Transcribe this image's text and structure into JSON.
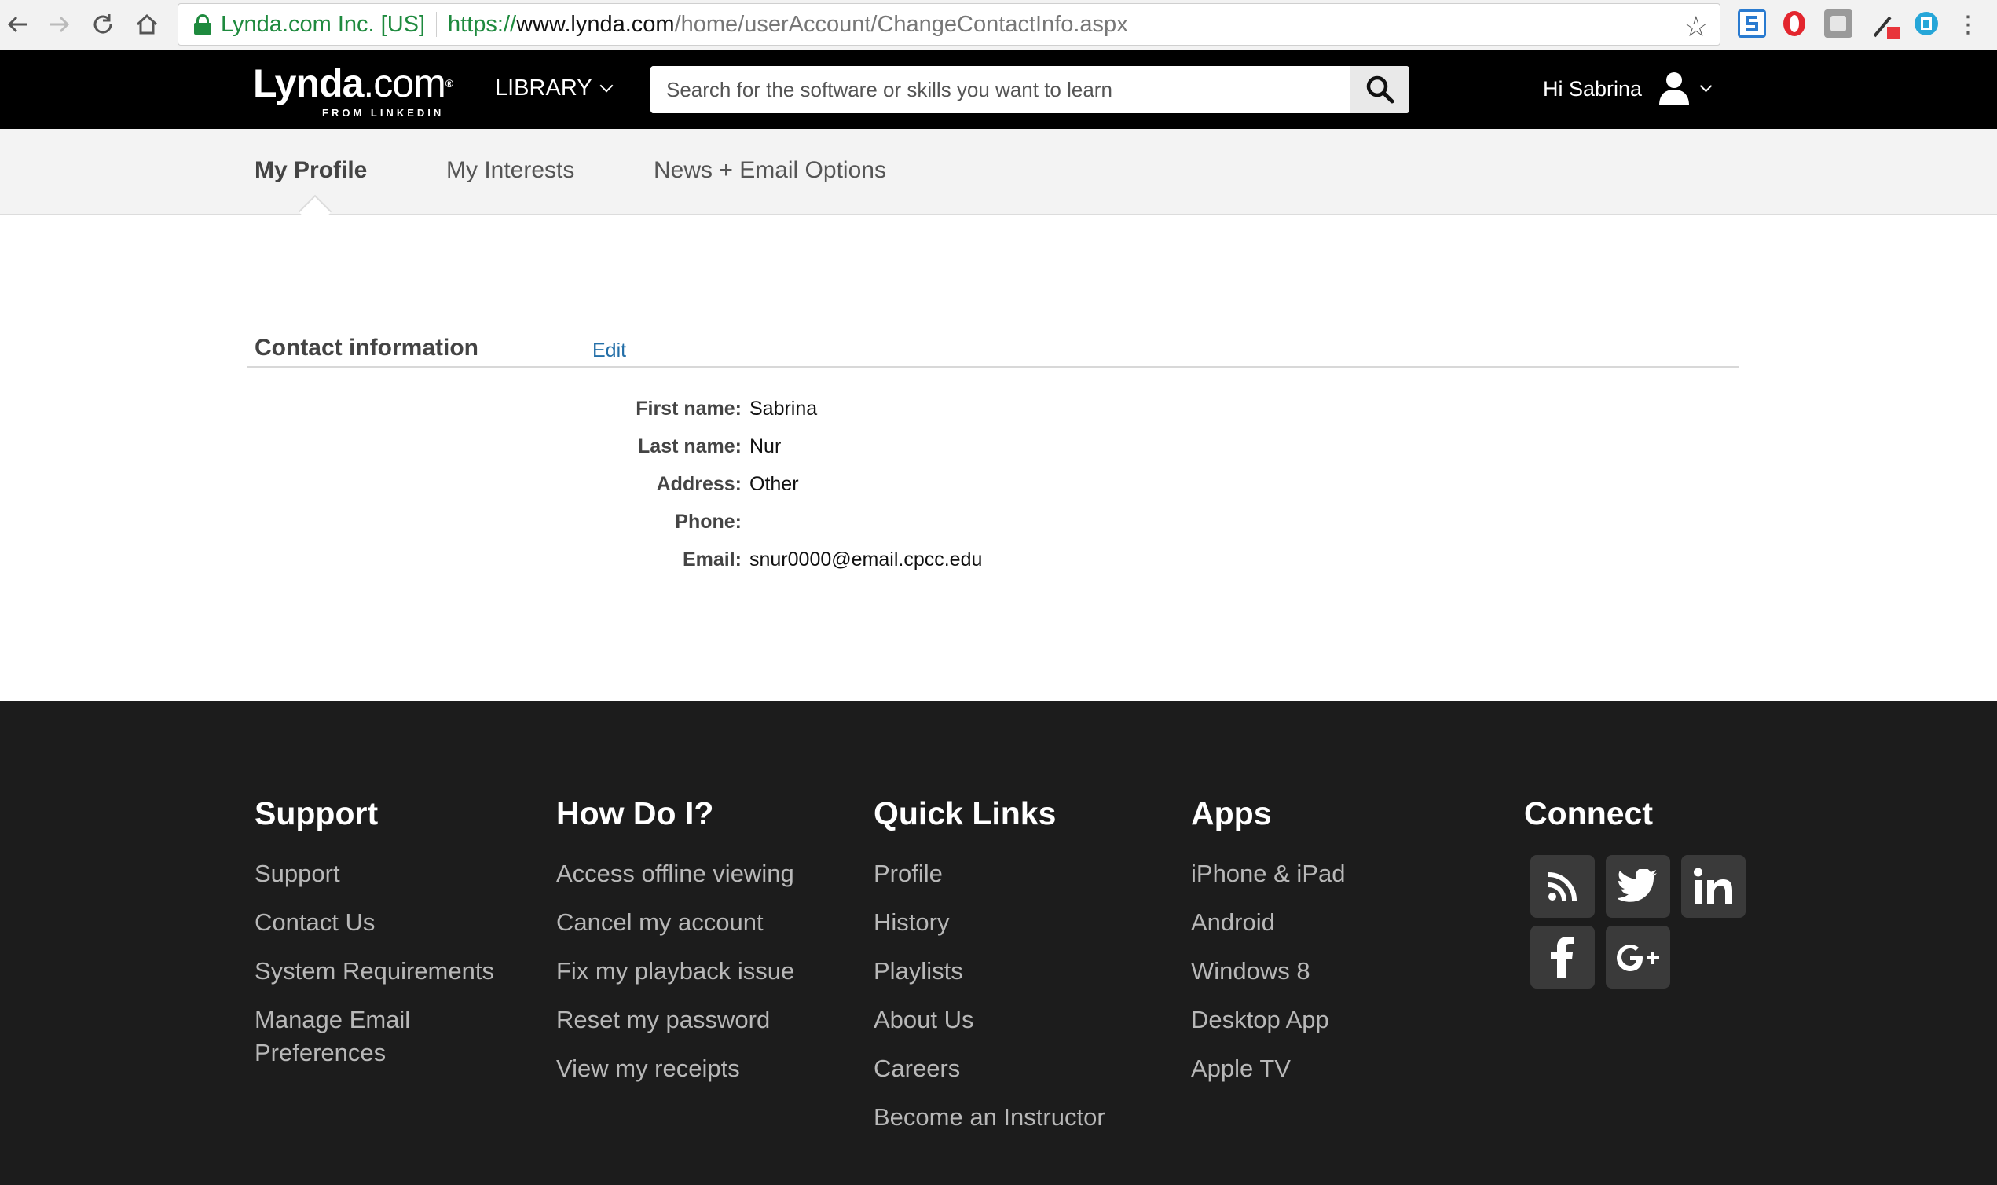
{
  "browser": {
    "secure_label": "Lynda.com Inc. [US]",
    "url_scheme": "https://",
    "url_host": "www.lynda.com",
    "url_path": "/home/userAccount/ChangeContactInfo.aspx"
  },
  "header": {
    "logo_main": "Lynda",
    "logo_dot": ".com",
    "logo_reg": "®",
    "logo_sub": "FROM LINKEDIN",
    "library_label": "LIBRARY",
    "search_placeholder": "Search for the software or skills you want to learn",
    "greeting": "Hi Sabrina"
  },
  "tabs": [
    {
      "label": "My Profile",
      "active": true
    },
    {
      "label": "My Interests",
      "active": false
    },
    {
      "label": "News + Email Options",
      "active": false
    }
  ],
  "contact": {
    "title": "Contact information",
    "edit_label": "Edit",
    "fields": [
      {
        "label": "First name:",
        "value": "Sabrina"
      },
      {
        "label": "Last name:",
        "value": "Nur"
      },
      {
        "label": "Address:",
        "value": "Other"
      },
      {
        "label": "Phone:",
        "value": ""
      },
      {
        "label": "Email:",
        "value": "snur0000@email.cpcc.edu"
      }
    ]
  },
  "footer": {
    "support": {
      "heading": "Support",
      "links": [
        "Support",
        "Contact Us",
        "System Requirements",
        "Manage Email",
        "Preferences"
      ]
    },
    "how_do_i": {
      "heading": "How Do I?",
      "links": [
        "Access offline viewing",
        "Cancel my account",
        "Fix my playback issue",
        "Reset my password",
        "View my receipts"
      ]
    },
    "quick_links": {
      "heading": "Quick Links",
      "links": [
        "Profile",
        "History",
        "Playlists",
        "About Us",
        "Careers",
        "Become an Instructor"
      ]
    },
    "apps": {
      "heading": "Apps",
      "links": [
        "iPhone & iPad",
        "Android",
        "Windows 8",
        "Desktop App",
        "Apple TV"
      ]
    },
    "connect": {
      "heading": "Connect",
      "icons": [
        "rss-icon",
        "twitter-icon",
        "linkedin-icon",
        "facebook-icon",
        "google-plus-icon"
      ]
    }
  },
  "colors": {
    "header_bg": "#000000",
    "footer_bg": "#1c1c1c",
    "link_blue": "#246fa8",
    "secure_green": "#1e8a3e"
  }
}
